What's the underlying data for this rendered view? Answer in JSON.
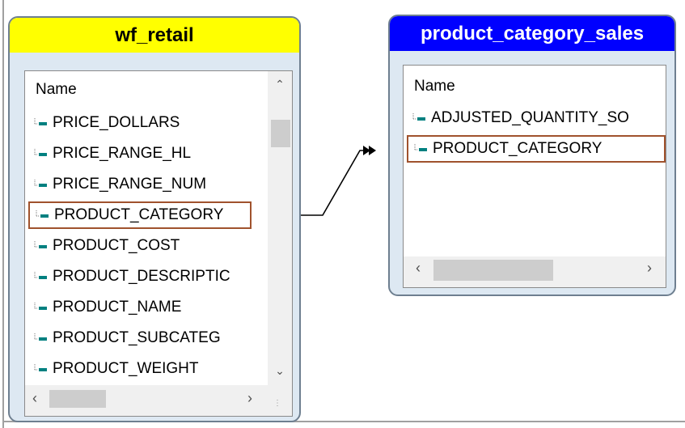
{
  "tables": [
    {
      "title": "wf_retail",
      "header_color": "#ffff00",
      "column_header": "Name",
      "fields": [
        {
          "label": "PRICE_DOLLARS",
          "selected": false
        },
        {
          "label": "PRICE_RANGE_HL",
          "selected": false
        },
        {
          "label": "PRICE_RANGE_NUM",
          "selected": false
        },
        {
          "label": "PRODUCT_CATEGORY",
          "selected": true
        },
        {
          "label": "PRODUCT_COST",
          "selected": false
        },
        {
          "label": "PRODUCT_DESCRIPTIC",
          "selected": false
        },
        {
          "label": "PRODUCT_NAME",
          "selected": false
        },
        {
          "label": "PRODUCT_SUBCATEG",
          "selected": false
        },
        {
          "label": "PRODUCT_WEIGHT",
          "selected": false
        }
      ]
    },
    {
      "title": "product_category_sales",
      "header_color": "#0000ff",
      "column_header": "Name",
      "fields": [
        {
          "label": "ADJUSTED_QUANTITY_SO",
          "selected": false
        },
        {
          "label": "PRODUCT_CATEGORY",
          "selected": true
        }
      ]
    }
  ],
  "join": {
    "from_field": "PRODUCT_CATEGORY",
    "to_field": "PRODUCT_CATEGORY",
    "line_color": "#000000"
  },
  "colors": {
    "field_icon": "#008080",
    "selection_border": "#a0522d",
    "table_frame": "#dde8f2"
  }
}
